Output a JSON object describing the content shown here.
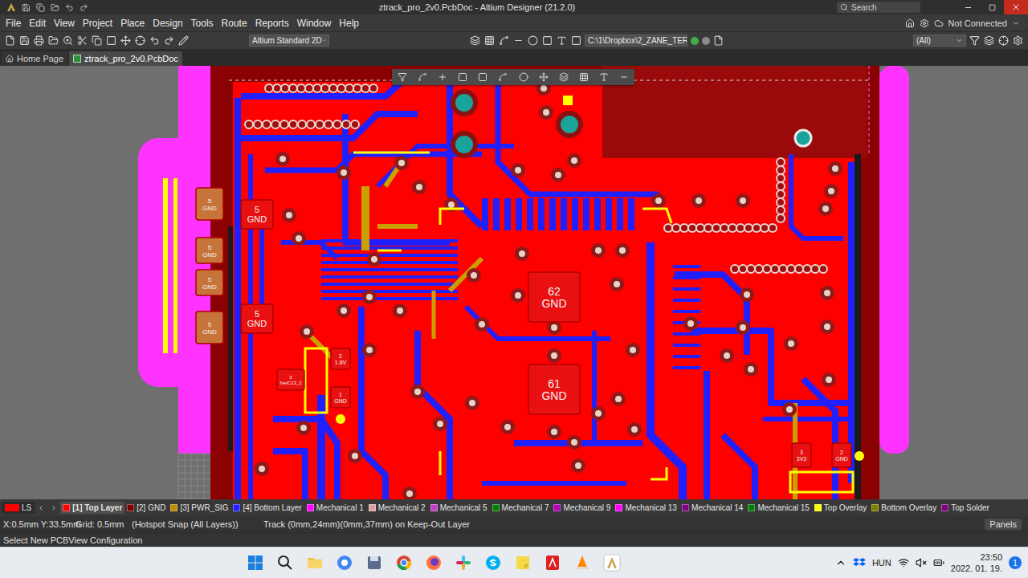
{
  "window": {
    "title": "ztrack_pro_2v0.PcbDoc - Altium Designer (21.2.0)"
  },
  "search": {
    "placeholder": "Search"
  },
  "menu": [
    "File",
    "Edit",
    "View",
    "Project",
    "Place",
    "Design",
    "Tools",
    "Route",
    "Reports",
    "Window",
    "Help"
  ],
  "account": {
    "label": "Not Connected"
  },
  "toolbar": {
    "view_config": "Altium Standard 2D",
    "path": "C:\\1\\Dropbox\\2_ZANE_TER",
    "filter": "(All)"
  },
  "doc_tabs": [
    {
      "label": "Home Page",
      "selected": false
    },
    {
      "label": "ztrack_pro_2v0.PcbDoc",
      "selected": true
    }
  ],
  "pads": [
    {
      "number": "5",
      "net": "GND"
    },
    {
      "number": "5",
      "net": "GND"
    },
    {
      "number": "5",
      "net": "GND"
    },
    {
      "number": "5",
      "net": "GND"
    },
    {
      "number": "5",
      "net": "GND"
    },
    {
      "number": "5",
      "net": "GND"
    },
    {
      "number": "62",
      "net": "GND"
    },
    {
      "number": "61",
      "net": "GND"
    },
    {
      "number": "2",
      "net": "1.8V"
    },
    {
      "number": "3",
      "net": "NetC13_2"
    },
    {
      "number": "1",
      "net": "GND"
    },
    {
      "number": "3",
      "net": "3V3"
    },
    {
      "number": "2",
      "net": "GND"
    }
  ],
  "layers_bar": {
    "current": "LS",
    "current_color": "#ff0000",
    "layers": [
      {
        "label": "[1] Top Layer",
        "color": "#ff0000",
        "selected": true
      },
      {
        "label": "[2] GND",
        "color": "#800000",
        "selected": false
      },
      {
        "label": "[3] PWR_SIG",
        "color": "#bc8e00",
        "selected": false
      },
      {
        "label": "[4] Bottom Layer",
        "color": "#2020ff",
        "selected": false
      },
      {
        "label": "Mechanical 1",
        "color": "#ff00ff",
        "selected": false
      },
      {
        "label": "Mechanical 2",
        "color": "#d8a0a0",
        "selected": false
      },
      {
        "label": "Mechanical 5",
        "color": "#c040c0",
        "selected": false
      },
      {
        "label": "Mechanical 7",
        "color": "#008000",
        "selected": false
      },
      {
        "label": "Mechanical 9",
        "color": "#b000b0",
        "selected": false
      },
      {
        "label": "Mechanical 13",
        "color": "#ff00ff",
        "selected": false
      },
      {
        "label": "Mechanical 14",
        "color": "#800080",
        "selected": false
      },
      {
        "label": "Mechanical 15",
        "color": "#008000",
        "selected": false
      },
      {
        "label": "Top Overlay",
        "color": "#ffff00",
        "selected": false
      },
      {
        "label": "Bottom Overlay",
        "color": "#808000",
        "selected": false
      },
      {
        "label": "Top Solder",
        "color": "#800080",
        "selected": false
      }
    ]
  },
  "status": {
    "coords": "X:0.5mm Y:33.5mm",
    "grid": "Grid: 0.5mm",
    "snap": "(Hotspot Snap (All Layers))",
    "object": "Track (0mm,24mm)(0mm,37mm) on Keep-Out Layer",
    "panels": "Panels",
    "hint": "Select New PCBView Configuration"
  },
  "taskbar": {
    "language": "HUN",
    "time": "23:50",
    "date": "2022. 01. 19.",
    "notifications": "1"
  }
}
